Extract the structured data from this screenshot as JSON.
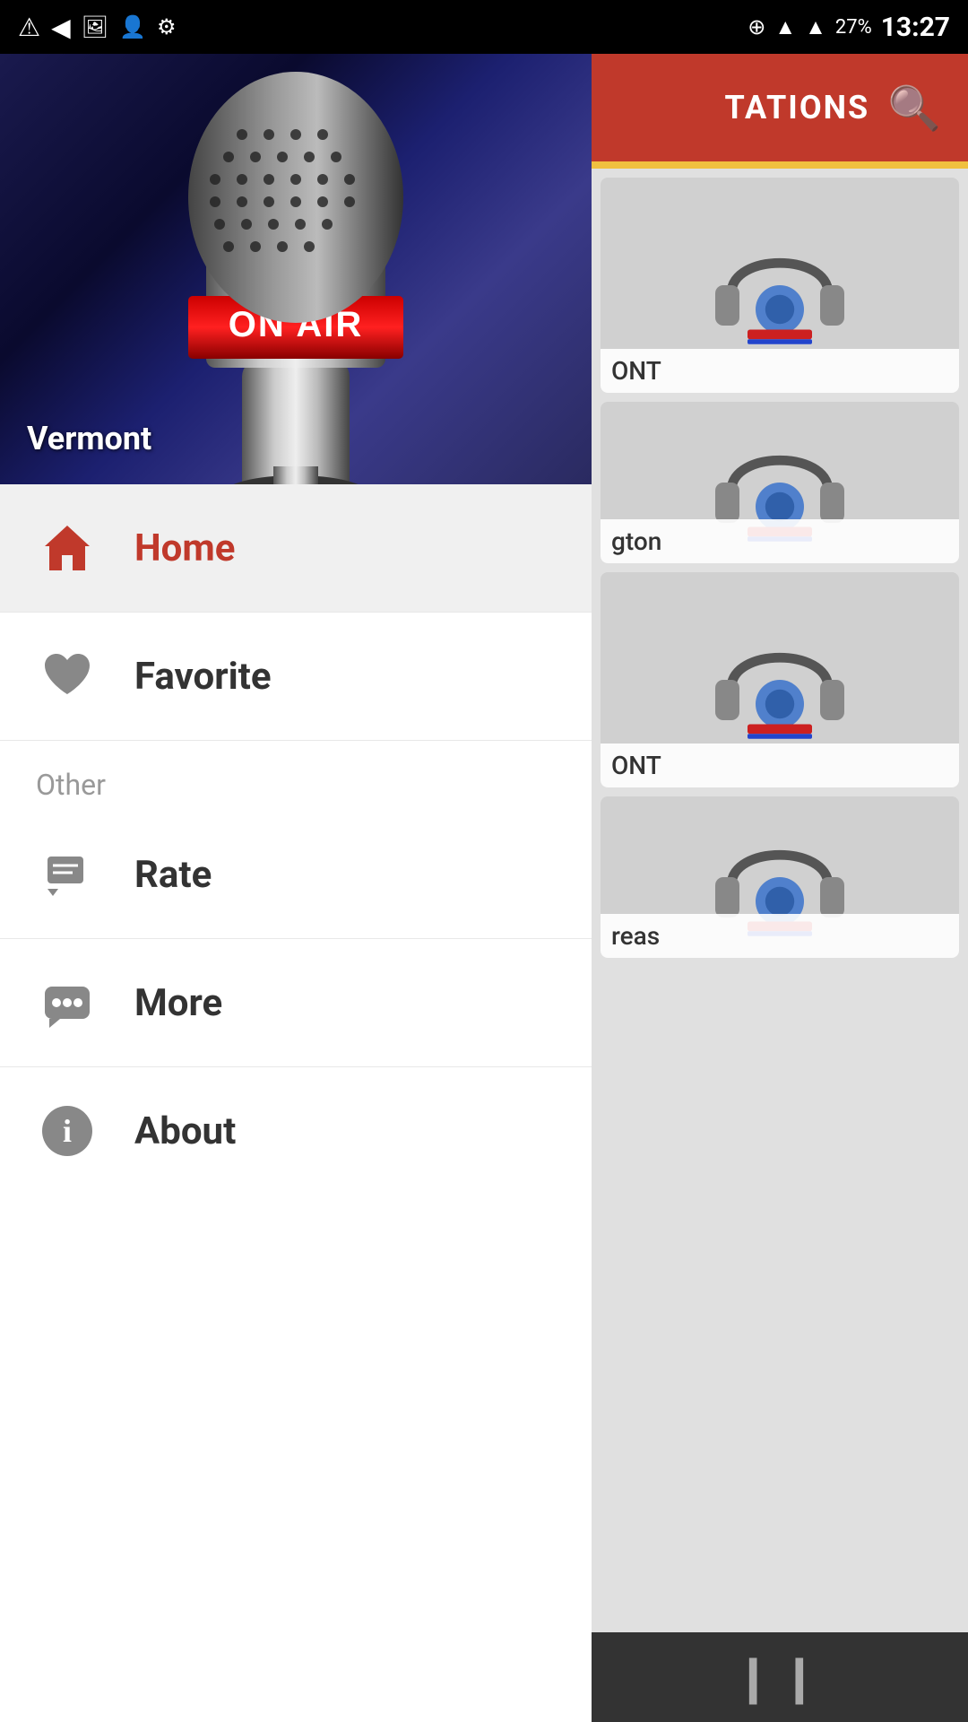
{
  "statusBar": {
    "time": "13:27",
    "battery": "27%",
    "icons": {
      "notification": "!",
      "back": "◀",
      "gallery": "🖼",
      "person": "👤",
      "wifi": "wifi-icon",
      "signal": "signal-icon"
    }
  },
  "hero": {
    "label": "Vermont"
  },
  "menu": {
    "items": [
      {
        "id": "home",
        "label": "Home",
        "icon": "home-icon",
        "active": true
      },
      {
        "id": "favorite",
        "label": "Favorite",
        "icon": "heart-icon",
        "active": false
      }
    ],
    "sectionHeader": "Other",
    "otherItems": [
      {
        "id": "rate",
        "label": "Rate",
        "icon": "rate-icon"
      },
      {
        "id": "more",
        "label": "More",
        "icon": "more-icon"
      },
      {
        "id": "about",
        "label": "About",
        "icon": "about-icon"
      }
    ]
  },
  "rightPanel": {
    "title": "TATIONS",
    "searchIcon": "search-icon",
    "stations": [
      {
        "id": "station1",
        "label": "ONT"
      },
      {
        "id": "station2",
        "label": "gton"
      },
      {
        "id": "station3",
        "label": "ONT"
      },
      {
        "id": "station4",
        "label": "reas"
      }
    ]
  },
  "colors": {
    "accent": "#c0392b",
    "yellow": "#f0c040",
    "activeMenuBg": "#f0f0f0",
    "menuText": "#333",
    "activeMenuText": "#c0392b",
    "sectionText": "#999"
  }
}
